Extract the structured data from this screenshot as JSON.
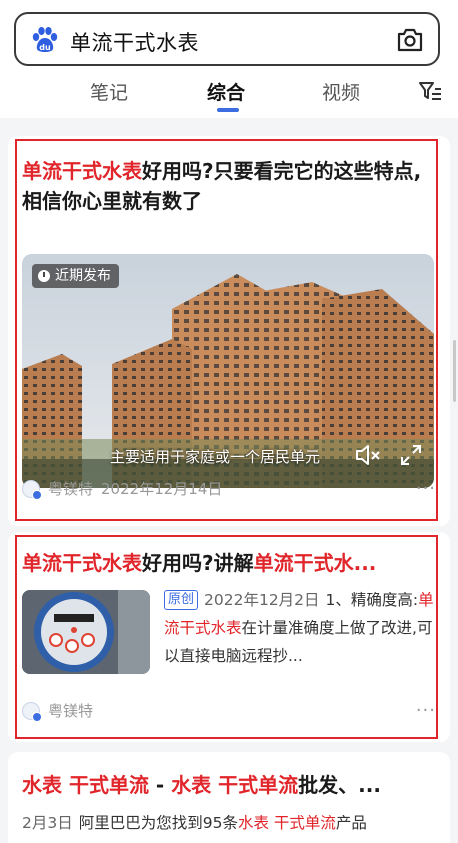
{
  "search": {
    "query": "单流干式水表",
    "icon": "baidu-paw-icon",
    "camera_icon": "camera-icon"
  },
  "tabs": [
    {
      "label": "笔记",
      "active": false
    },
    {
      "label": "综合",
      "active": true
    },
    {
      "label": "视频",
      "active": false
    }
  ],
  "colors": {
    "highlight": "#e0262b",
    "accent": "#3b6de0",
    "annotation_box": "#e0262b"
  },
  "results": [
    {
      "title_hl": "单流干式水表",
      "title_rest": "好用吗?只要看完它的这些特点,相信你心里就有数了",
      "video_badge": "近期发布",
      "video_subtitle": "主要适用于家庭或一个居民单元",
      "author": "粤镁特",
      "date": "2022年12月14日",
      "more": "···"
    },
    {
      "title_hl1": "单流干式水表",
      "title_mid": "好用吗?讲解",
      "title_hl2": "单流干式水...",
      "tag": "原创",
      "date": "2022年12月2日",
      "snippet_a": "1、精确度高:",
      "snippet_hl": "单流干式水表",
      "snippet_b": "在计量准确度上做了改进,可以直接电脑远程抄...",
      "author": "粤镁特",
      "more": "···"
    },
    {
      "title_hl1": "水表 干式单流",
      "title_sep": " - ",
      "title_hl2": "水表 干式单流",
      "title_rest": "批发、...",
      "date": "2月3日",
      "snippet_a": "阿里巴巴为您找到95条",
      "snippet_hl": "水表 干式单流",
      "snippet_b": "产品"
    }
  ]
}
